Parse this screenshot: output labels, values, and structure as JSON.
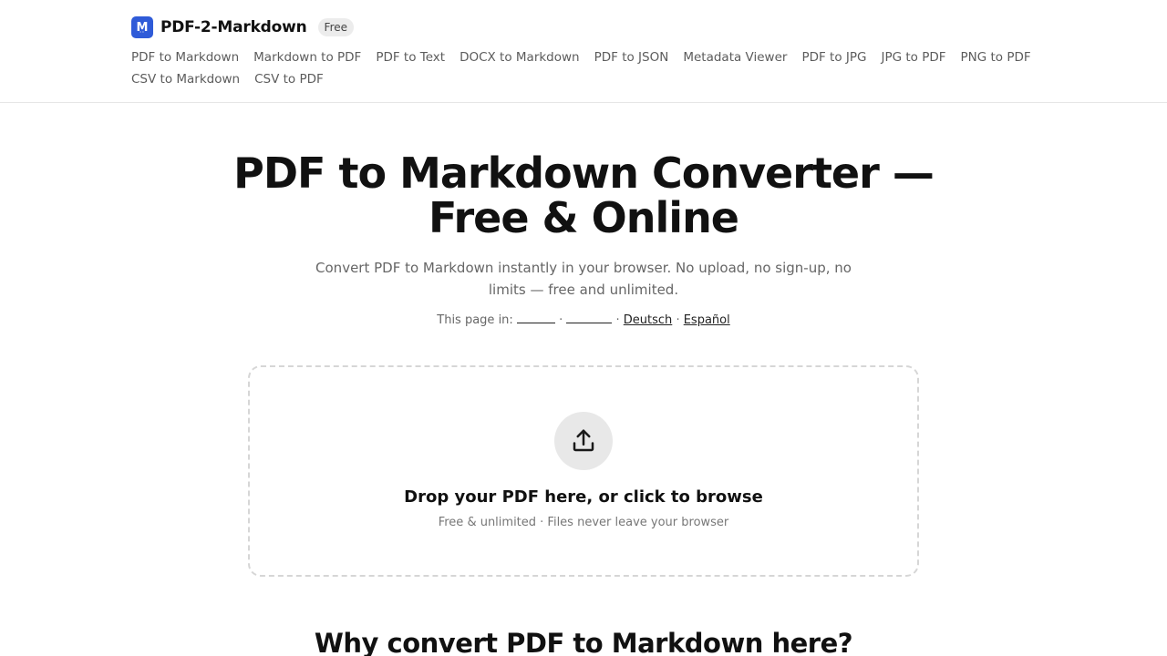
{
  "brand": {
    "name": "PDF-2-Markdown",
    "logo_letter": "M",
    "badge": "Free",
    "accent_color": "#2f5bd8"
  },
  "nav": {
    "items": [
      "PDF to Markdown",
      "Markdown to PDF",
      "PDF to Text",
      "DOCX to Markdown",
      "PDF to JSON",
      "Metadata Viewer",
      "PDF to JPG",
      "JPG to PDF",
      "PNG to PDF",
      "CSV to Markdown",
      "CSV to PDF"
    ]
  },
  "hero": {
    "title_line1": "PDF to Markdown Converter —",
    "title_line2": "Free & Online",
    "subtitle": "Convert PDF to Markdown instantly in your browser. No upload, no sign-up, no limits — free and unlimited.",
    "lang_prefix": "This page in:",
    "separator": "·",
    "languages": [
      "Deutsch",
      "Español"
    ]
  },
  "dropzone": {
    "icon": "upload-icon",
    "title": "Drop your PDF here, or click to browse",
    "note": "Free & unlimited · Files never leave your browser"
  },
  "section": {
    "title": "Why convert PDF to Markdown here?"
  }
}
